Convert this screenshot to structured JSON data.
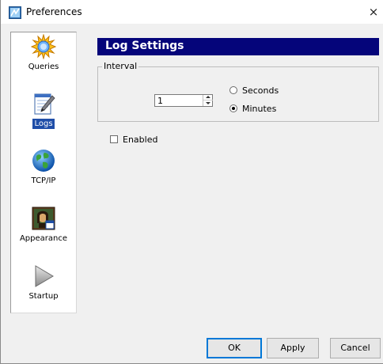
{
  "window": {
    "title": "Preferences",
    "close_glyph": "×"
  },
  "sidebar": {
    "items": [
      {
        "label": "Queries",
        "icon": "sun-icon",
        "selected": false
      },
      {
        "label": "Logs",
        "icon": "notepad-pencil-icon",
        "selected": true
      },
      {
        "label": "TCP/IP",
        "icon": "globe-icon",
        "selected": false
      },
      {
        "label": "Appearance",
        "icon": "portrait-icon",
        "selected": false
      },
      {
        "label": "Startup",
        "icon": "play-arrow-icon",
        "selected": false
      }
    ]
  },
  "panel": {
    "header": "Log Settings",
    "header_color": "#05057a",
    "interval": {
      "legend": "Interval",
      "value": "1",
      "options": [
        {
          "label": "Seconds",
          "selected": false
        },
        {
          "label": "Minutes",
          "selected": true
        }
      ]
    },
    "enabled": {
      "label": "Enabled",
      "checked": false
    }
  },
  "buttons": {
    "ok": "OK",
    "apply": "Apply",
    "cancel": "Cancel"
  }
}
